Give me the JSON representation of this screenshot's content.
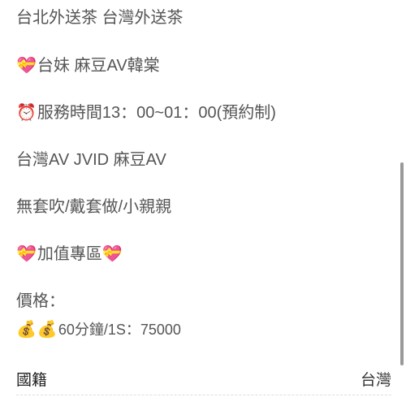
{
  "post": {
    "lines": [
      {
        "icon": "",
        "text": "台北外送茶  台灣外送茶"
      },
      {
        "icon": "heart-gift-icon",
        "text": "台妹 麻豆AV韓棠"
      },
      {
        "icon": "alarm-clock-icon",
        "text": "服務時間13：00~01：00(預約制)"
      },
      {
        "icon": "",
        "text": "台灣AV JVID 麻豆AV"
      },
      {
        "icon": "",
        "text": "無套吹/戴套做/小親親"
      },
      {
        "icon": "heart-gift-icon",
        "text": "加值專區"
      },
      {
        "icon": "",
        "text": "價格："
      },
      {
        "icon": "money-bag-icon",
        "text": "60分鐘/1S：75000"
      }
    ]
  },
  "details": {
    "nationality_label": "國籍",
    "nationality_value": "台灣"
  },
  "colors": {
    "text": "#555555",
    "label": "#222222",
    "scrollbar": "#999999"
  }
}
